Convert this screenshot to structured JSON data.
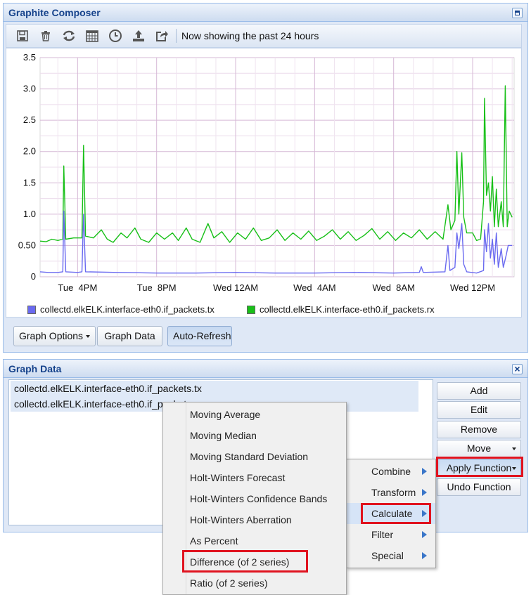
{
  "composer": {
    "title": "Graphite Composer",
    "toolbar_status": "Now showing the past 24 hours",
    "toolbar_icons": [
      "save-icon",
      "trash-icon",
      "refresh-icon",
      "calendar-icon",
      "clock-icon",
      "upload-icon",
      "share-icon"
    ],
    "buttons": {
      "graph_options": "Graph Options",
      "graph_data": "Graph Data",
      "auto_refresh": "Auto-Refresh"
    }
  },
  "chart_data": {
    "type": "line",
    "title": "",
    "xlabel": "",
    "ylabel": "",
    "ylim": [
      0,
      3.5
    ],
    "y_ticks": [
      "0",
      "0.50",
      "1.0",
      "1.5",
      "2.0",
      "2.5",
      "3.0",
      "3.5"
    ],
    "x_ticks": [
      "Tue  4PM",
      "Tue  8PM",
      "Wed 12AM",
      "Wed  4AM",
      "Wed  8AM",
      "Wed 12PM"
    ],
    "x_range_hours": [
      14.1,
      38.1
    ],
    "grid": true,
    "legend_position": "bottom",
    "series": [
      {
        "name": "collectd.elkELK.interface-eth0.if_packets.tx",
        "color": "#6a6af0",
        "points": [
          [
            14.1,
            0.08
          ],
          [
            14.5,
            0.07
          ],
          [
            15.0,
            0.07
          ],
          [
            15.25,
            0.08
          ],
          [
            15.3,
            1.05
          ],
          [
            15.4,
            0.08
          ],
          [
            16.0,
            0.07
          ],
          [
            16.22,
            0.08
          ],
          [
            16.3,
            1.0
          ],
          [
            16.4,
            0.08
          ],
          [
            18,
            0.07
          ],
          [
            20,
            0.06
          ],
          [
            22,
            0.06
          ],
          [
            24,
            0.07
          ],
          [
            26,
            0.06
          ],
          [
            28,
            0.06
          ],
          [
            30,
            0.07
          ],
          [
            32,
            0.06
          ],
          [
            33.3,
            0.07
          ],
          [
            33.4,
            0.16
          ],
          [
            33.5,
            0.07
          ],
          [
            34.6,
            0.08
          ],
          [
            34.75,
            0.5
          ],
          [
            34.85,
            0.1
          ],
          [
            35.1,
            0.15
          ],
          [
            35.2,
            0.7
          ],
          [
            35.3,
            0.45
          ],
          [
            35.45,
            0.85
          ],
          [
            35.55,
            0.2
          ],
          [
            35.7,
            0.08
          ],
          [
            36.2,
            0.06
          ],
          [
            36.55,
            0.1
          ],
          [
            36.6,
            0.75
          ],
          [
            36.7,
            0.4
          ],
          [
            36.8,
            0.85
          ],
          [
            36.9,
            0.3
          ],
          [
            37.0,
            0.6
          ],
          [
            37.1,
            0.2
          ],
          [
            37.2,
            0.7
          ],
          [
            37.3,
            0.15
          ],
          [
            37.45,
            0.45
          ],
          [
            37.55,
            0.15
          ],
          [
            37.7,
            0.35
          ],
          [
            37.8,
            0.5
          ],
          [
            38.0,
            0.5
          ]
        ]
      },
      {
        "name": "collectd.elkELK.interface-eth0.if_packets.rx",
        "color": "#18c018",
        "points": [
          [
            14.1,
            0.57
          ],
          [
            14.4,
            0.56
          ],
          [
            14.7,
            0.6
          ],
          [
            15.0,
            0.58
          ],
          [
            15.25,
            0.6
          ],
          [
            15.3,
            1.77
          ],
          [
            15.4,
            0.6
          ],
          [
            15.8,
            0.62
          ],
          [
            16.22,
            0.62
          ],
          [
            16.3,
            2.1
          ],
          [
            16.4,
            0.65
          ],
          [
            16.8,
            0.62
          ],
          [
            17.2,
            0.75
          ],
          [
            17.5,
            0.6
          ],
          [
            17.8,
            0.55
          ],
          [
            18.2,
            0.7
          ],
          [
            18.5,
            0.62
          ],
          [
            18.9,
            0.78
          ],
          [
            19.2,
            0.6
          ],
          [
            19.6,
            0.55
          ],
          [
            20.0,
            0.7
          ],
          [
            20.4,
            0.6
          ],
          [
            20.8,
            0.7
          ],
          [
            21.1,
            0.58
          ],
          [
            21.5,
            0.78
          ],
          [
            21.8,
            0.6
          ],
          [
            22.2,
            0.55
          ],
          [
            22.6,
            0.85
          ],
          [
            22.9,
            0.62
          ],
          [
            23.3,
            0.72
          ],
          [
            23.7,
            0.55
          ],
          [
            24.1,
            0.7
          ],
          [
            24.5,
            0.6
          ],
          [
            24.9,
            0.78
          ],
          [
            25.3,
            0.58
          ],
          [
            25.7,
            0.62
          ],
          [
            26.1,
            0.75
          ],
          [
            26.5,
            0.58
          ],
          [
            26.9,
            0.7
          ],
          [
            27.3,
            0.6
          ],
          [
            27.7,
            0.73
          ],
          [
            28.1,
            0.58
          ],
          [
            28.5,
            0.65
          ],
          [
            28.9,
            0.75
          ],
          [
            29.3,
            0.6
          ],
          [
            29.7,
            0.72
          ],
          [
            30.1,
            0.58
          ],
          [
            30.5,
            0.66
          ],
          [
            30.9,
            0.77
          ],
          [
            31.3,
            0.6
          ],
          [
            31.7,
            0.72
          ],
          [
            32.1,
            0.58
          ],
          [
            32.5,
            0.7
          ],
          [
            32.9,
            0.62
          ],
          [
            33.3,
            0.75
          ],
          [
            33.7,
            0.6
          ],
          [
            34.1,
            0.72
          ],
          [
            34.5,
            0.6
          ],
          [
            34.75,
            1.15
          ],
          [
            34.9,
            0.75
          ],
          [
            35.1,
            0.9
          ],
          [
            35.2,
            2.0
          ],
          [
            35.3,
            1.0
          ],
          [
            35.45,
            1.98
          ],
          [
            35.55,
            0.95
          ],
          [
            35.7,
            0.7
          ],
          [
            36.0,
            0.7
          ],
          [
            36.2,
            0.58
          ],
          [
            36.4,
            0.6
          ],
          [
            36.55,
            1.2
          ],
          [
            36.6,
            2.85
          ],
          [
            36.7,
            1.3
          ],
          [
            36.8,
            1.5
          ],
          [
            36.9,
            1.05
          ],
          [
            37.0,
            1.6
          ],
          [
            37.1,
            0.8
          ],
          [
            37.2,
            1.4
          ],
          [
            37.3,
            0.8
          ],
          [
            37.45,
            1.2
          ],
          [
            37.55,
            0.8
          ],
          [
            37.65,
            3.05
          ],
          [
            37.75,
            0.8
          ],
          [
            37.85,
            1.05
          ],
          [
            38.0,
            0.95
          ]
        ]
      }
    ]
  },
  "graph_data_panel": {
    "title": "Graph Data",
    "targets": [
      "collectd.elkELK.interface-eth0.if_packets.tx",
      "collectd.elkELK.interface-eth0.if_packets.rx"
    ],
    "buttons": {
      "add": "Add",
      "edit": "Edit",
      "remove": "Remove",
      "move": "Move",
      "apply_function": "Apply Function",
      "undo_function": "Undo Function"
    }
  },
  "function_menu": {
    "categories": [
      "Combine",
      "Transform",
      "Calculate",
      "Filter",
      "Special"
    ],
    "active_category": "Calculate",
    "calculate_items": [
      "Moving Average",
      "Moving Median",
      "Moving Standard Deviation",
      "Holt-Winters Forecast",
      "Holt-Winters Confidence Bands",
      "Holt-Winters Aberration",
      "As Percent",
      "Difference (of 2 series)",
      "Ratio (of 2 series)"
    ],
    "highlighted_item": "Difference (of 2 series)"
  },
  "colors": {
    "highlight_box": "#e0131f",
    "panel_title": "#15428b"
  }
}
